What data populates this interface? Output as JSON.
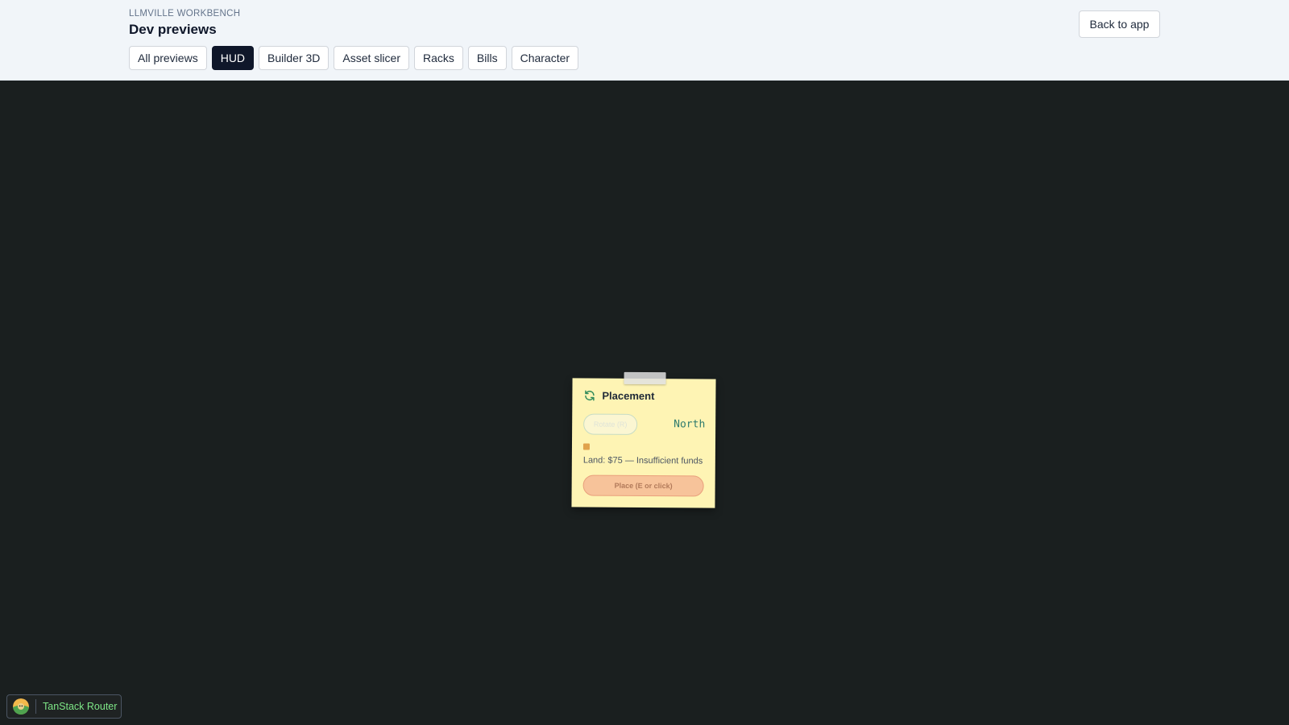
{
  "header": {
    "brand": "LLMVILLE WORKBENCH",
    "title": "Dev previews",
    "back_label": "Back to app",
    "tabs": [
      {
        "label": "All previews",
        "active": false
      },
      {
        "label": "HUD",
        "active": true
      },
      {
        "label": "Builder 3D",
        "active": false
      },
      {
        "label": "Asset slicer",
        "active": false
      },
      {
        "label": "Racks",
        "active": false
      },
      {
        "label": "Bills",
        "active": false
      },
      {
        "label": "Character",
        "active": false
      }
    ]
  },
  "placement_card": {
    "icon": "refresh-icon",
    "title": "Placement",
    "rotate_label": "Rotate (R)",
    "direction": "North",
    "cost_text": "Land: $75 — Insufficient funds",
    "place_label": "Place (E or click)"
  },
  "devtools": {
    "label": "TanStack Router"
  },
  "colors": {
    "stage_bg": "#1a1f1f",
    "note_bg": "#fef4b4",
    "accent_active_tab": "#0f172a",
    "direction_text": "#2f7b6e",
    "place_button": "#f7c39a",
    "router_label": "#7ee787"
  }
}
